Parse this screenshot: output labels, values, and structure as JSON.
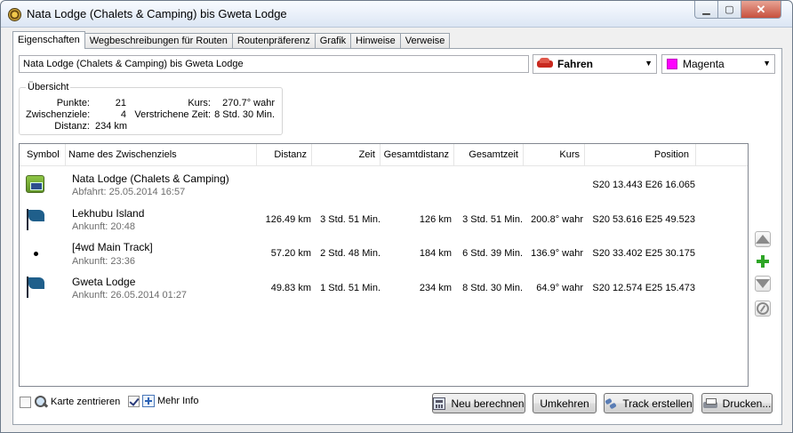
{
  "window": {
    "title": "Nata Lodge (Chalets & Camping) bis Gweta Lodge",
    "min_glyph": "▁",
    "max_glyph": "▢",
    "close_glyph": "✕"
  },
  "tabs": [
    {
      "label": "Eigenschaften",
      "active": true
    },
    {
      "label": "Wegbeschreibungen für Routen",
      "active": false
    },
    {
      "label": "Routenpräferenz",
      "active": false
    },
    {
      "label": "Grafik",
      "active": false
    },
    {
      "label": "Hinweise",
      "active": false
    },
    {
      "label": "Verweise",
      "active": false
    }
  ],
  "route_name": "Nata Lodge (Chalets & Camping) bis Gweta Lodge",
  "mode_select": {
    "value": "Fahren",
    "icon": "car-icon"
  },
  "color_select": {
    "value": "Magenta",
    "color": "#ff00ff"
  },
  "overview": {
    "legend": "Übersicht",
    "punkte_label": "Punkte:",
    "punkte_value": "21",
    "zwischenziele_label": "Zwischenziele:",
    "zwischenziele_value": "4",
    "distanz_label": "Distanz:",
    "distanz_value": "234 km",
    "kurs_label": "Kurs:",
    "kurs_value": "270.7° wahr",
    "zeit_label": "Verstrichene Zeit:",
    "zeit_value": "8 Std. 30 Min."
  },
  "table": {
    "headers": {
      "symbol": "Symbol",
      "name": "Name des Zwischenziels",
      "distanz": "Distanz",
      "zeit": "Zeit",
      "gesamtdistanz": "Gesamtdistanz",
      "gesamtzeit": "Gesamtzeit",
      "kurs": "Kurs",
      "position": "Position"
    },
    "rows": [
      {
        "symbol": "start-icon",
        "name": "Nata Lodge (Chalets & Camping)",
        "sub": "Abfahrt: 25.05.2014 16:57",
        "distanz": "",
        "zeit": "",
        "gesamtdistanz": "",
        "gesamtzeit": "",
        "kurs": "",
        "position": "S20 13.443 E26 16.065"
      },
      {
        "symbol": "flag-icon",
        "name": "Lekhubu Island",
        "sub": "Ankunft: 20:48",
        "distanz": "126.49 km",
        "zeit": "3 Std. 51 Min.",
        "gesamtdistanz": "126 km",
        "gesamtzeit": "3 Std. 51 Min.",
        "kurs": "200.8° wahr",
        "position": "S20 53.616 E25 49.523"
      },
      {
        "symbol": "dot-icon",
        "name": "[4wd Main Track]",
        "sub": "Ankunft: 23:36",
        "distanz": "57.20 km",
        "zeit": "2 Std. 48 Min.",
        "gesamtdistanz": "184 km",
        "gesamtzeit": "6 Std. 39 Min.",
        "kurs": "136.9° wahr",
        "position": "S20 33.402 E25 30.175"
      },
      {
        "symbol": "flag-icon",
        "name": "Gweta Lodge",
        "sub": "Ankunft: 26.05.2014 01:27",
        "distanz": "49.83 km",
        "zeit": "1 Std. 51 Min.",
        "gesamtdistanz": "234 km",
        "gesamtzeit": "8 Std. 30 Min.",
        "kurs": "64.9° wahr",
        "position": "S20 12.574 E25 15.473"
      }
    ]
  },
  "side_buttons": [
    "arrow-up-icon",
    "add-icon",
    "arrow-down-icon",
    "compass-icon"
  ],
  "footer": {
    "center_map_label": "Karte zentrieren",
    "center_map_checked": false,
    "more_info_label": "Mehr Info",
    "more_info_checked": true,
    "recalc_label": "Neu berechnen",
    "reverse_label": "Umkehren",
    "create_track_label": "Track erstellen",
    "print_label": "Drucken..."
  }
}
